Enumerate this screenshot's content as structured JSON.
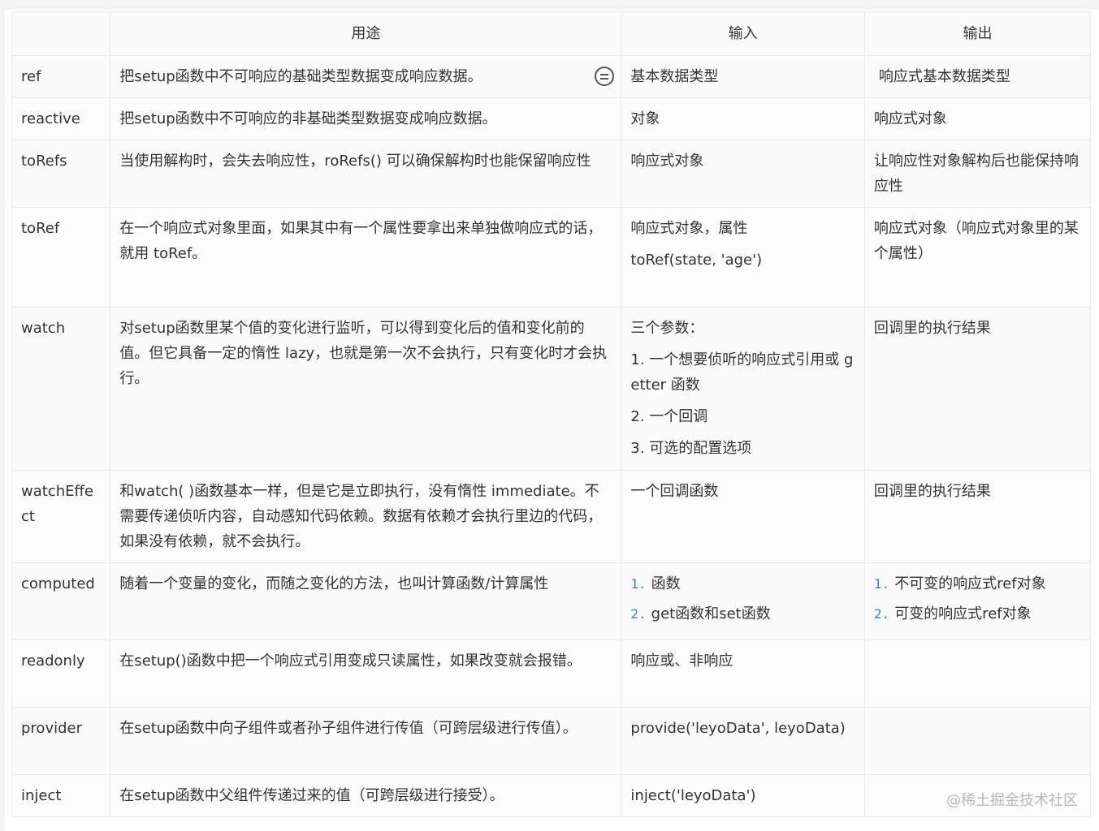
{
  "table": {
    "headers": [
      "",
      "用途",
      "输入",
      "输出"
    ],
    "rows": [
      {
        "api": "ref",
        "use": "把setup函数中不可响应的基础类型数据变成响应数据。",
        "input": [
          "基本数据类型"
        ],
        "output": [
          "响应式基本数据类型"
        ]
      },
      {
        "api": "reactive",
        "use": "把setup函数中不可响应的非基础类型数据变成响应数据。",
        "input": [
          "对象"
        ],
        "output": [
          "响应式对象"
        ]
      },
      {
        "api": "toRefs",
        "use": "当使用解构时，会失去响应性，roRefs() 可以确保解构时也能保留响应性",
        "input": [
          "响应式对象"
        ],
        "output": [
          "让响应性对象解构后也能保持响应性"
        ]
      },
      {
        "api": "toRef",
        "use": "在一个响应式对象里面，如果其中有一个属性要拿出来单独做响应式的话，就用 toRef。",
        "input": [
          "响应式对象，属性",
          "toRef(state, 'age')"
        ],
        "output": [
          "响应式对象（响应式对象里的某个属性）"
        ]
      },
      {
        "api": "watch",
        "use": "对setup函数里某个值的变化进行监听，可以得到变化后的值和变化前的值。但它具备一定的惰性 lazy，也就是第一次不会执行，只有变化时才会执行。",
        "input": [
          "三个参数：",
          "1. 一个想要侦听的响应式引用或 getter 函数",
          "2. 一个回调",
          "3. 可选的配置选项"
        ],
        "output": [
          "回调里的执行结果"
        ]
      },
      {
        "api": "watchEffect",
        "use": "和watch( )函数基本一样，但是它是立即执行，没有惰性 immediate。不需要传递侦听内容，自动感知代码依赖。数据有依赖才会执行里边的代码，如果没有依赖，就不会执行。",
        "input": [
          "一个回调函数"
        ],
        "output": [
          "回调里的执行结果"
        ]
      },
      {
        "api": "computed",
        "use": "随着一个变量的变化，而随之变化的方法，也叫计算函数/计算属性",
        "input_list": [
          {
            "num": "1.",
            "text": "函数"
          },
          {
            "num": "2.",
            "text": "get函数和set函数"
          }
        ],
        "output_list": [
          {
            "num": "1.",
            "text": "不可变的响应式ref对象"
          },
          {
            "num": "2.",
            "text": "可变的响应式ref对象"
          }
        ]
      },
      {
        "api": "readonly",
        "use": "在setup()函数中把一个响应式引用变成只读属性，如果改变就会报错。",
        "input": [
          "响应或、非响应"
        ],
        "output": []
      },
      {
        "api": "provider",
        "use": "在setup函数中向子组件或者孙子组件进行传值（可跨层级进行传值）。",
        "input": [
          "provide('leyoData', leyoData)"
        ],
        "output": []
      },
      {
        "api": "inject",
        "use": "在setup函数中父组件传递过来的值（可跨层级进行接受）。",
        "input": [
          "inject('leyoData')"
        ],
        "output": []
      }
    ]
  },
  "icons": {
    "row_menu": "menu-circle-icon"
  },
  "colors": {
    "border": "#e8e8e8",
    "list_number": "#3b82d6",
    "watermark": "#b8b8b8"
  },
  "watermark": "@稀土掘金技术社区"
}
